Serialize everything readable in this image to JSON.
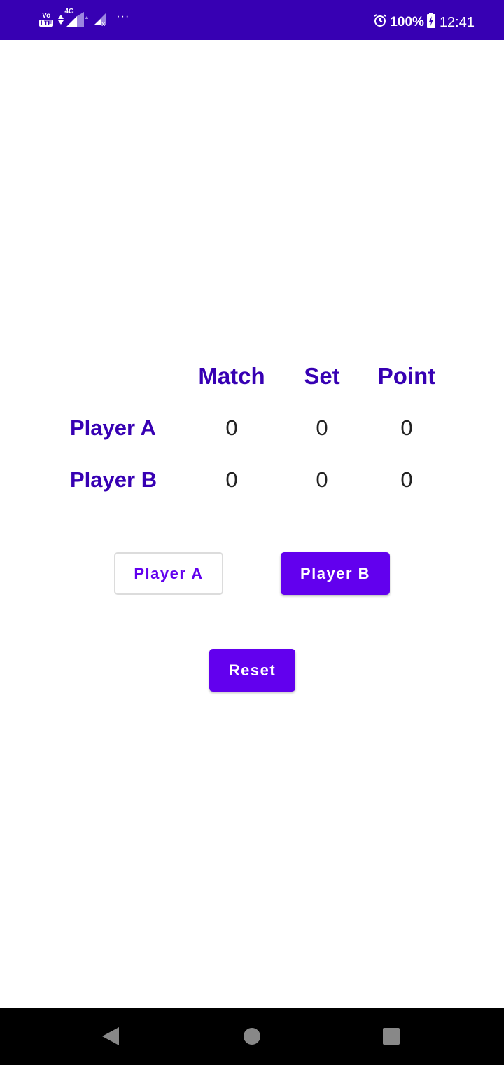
{
  "status_bar": {
    "network_volte": "Vo",
    "network_lte": "LTE",
    "network_type": "4G",
    "more": "···",
    "battery": "100%",
    "time": "12:41"
  },
  "scoreboard": {
    "columns": [
      "Match",
      "Set",
      "Point"
    ],
    "rows": [
      {
        "player": "Player A",
        "match": "0",
        "set": "0",
        "point": "0"
      },
      {
        "player": "Player B",
        "match": "0",
        "set": "0",
        "point": "0"
      }
    ]
  },
  "buttons": {
    "player_a_label": "Player A",
    "player_b_label": "Player B",
    "reset_label": "Reset"
  },
  "colors": {
    "status_bar": "#3700b3",
    "primary": "#6200ee",
    "header_text": "#3700b3"
  },
  "nav": {
    "back_icon": "back-triangle",
    "home_icon": "home-circle",
    "recents_icon": "recents-square"
  }
}
